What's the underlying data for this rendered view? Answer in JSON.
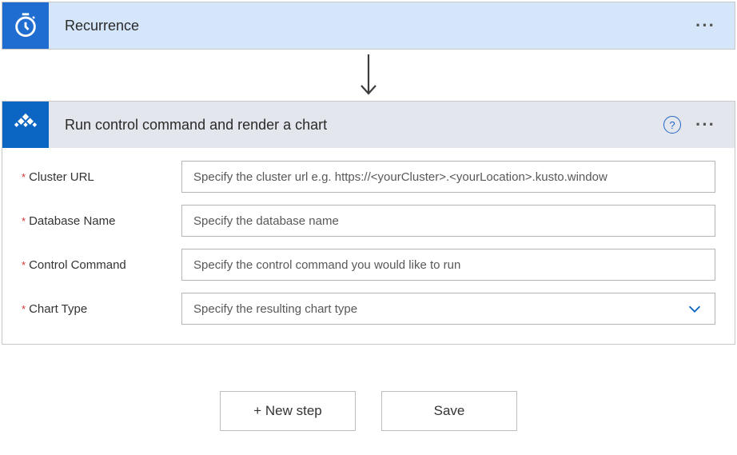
{
  "recurrence": {
    "title": "Recurrence"
  },
  "kusto": {
    "title": "Run control command and render a chart",
    "fields": {
      "cluster_url": {
        "label": "Cluster URL",
        "placeholder": "Specify the cluster url e.g. https://<yourCluster>.<yourLocation>.kusto.window"
      },
      "database_name": {
        "label": "Database Name",
        "placeholder": "Specify the database name"
      },
      "control_command": {
        "label": "Control Command",
        "placeholder": "Specify the control command you would like to run"
      },
      "chart_type": {
        "label": "Chart Type",
        "placeholder": "Specify the resulting chart type"
      }
    }
  },
  "footer": {
    "new_step": "+ New step",
    "save": "Save"
  }
}
